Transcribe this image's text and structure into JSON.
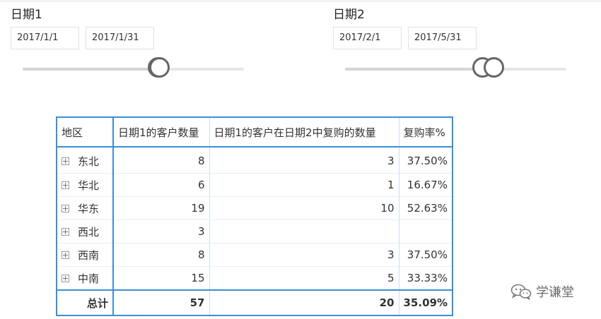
{
  "slicers": [
    {
      "title": "日期1",
      "start": "2017/1/1",
      "end": "2017/1/31"
    },
    {
      "title": "日期2",
      "start": "2017/2/1",
      "end": "2017/5/31"
    }
  ],
  "matrix": {
    "headers": [
      "地区",
      "日期1的客户数量",
      "日期1的客户在日期2中复购的数量",
      "复购率%"
    ],
    "rows": [
      {
        "region": "东北",
        "count": "8",
        "repurchase": "3",
        "rate": "37.50%"
      },
      {
        "region": "华北",
        "count": "6",
        "repurchase": "1",
        "rate": "16.67%"
      },
      {
        "region": "华东",
        "count": "19",
        "repurchase": "10",
        "rate": "52.63%"
      },
      {
        "region": "西北",
        "count": "3",
        "repurchase": "",
        "rate": ""
      },
      {
        "region": "西南",
        "count": "8",
        "repurchase": "3",
        "rate": "37.50%"
      },
      {
        "region": "中南",
        "count": "15",
        "repurchase": "5",
        "rate": "33.33%"
      }
    ],
    "total": {
      "label": "总计",
      "count": "57",
      "repurchase": "20",
      "rate": "35.09%"
    }
  },
  "watermark": {
    "text": "学谦堂",
    "icon": "wechat-icon"
  },
  "colors": {
    "accent": "#3a8fd8",
    "handle": "#666666"
  }
}
